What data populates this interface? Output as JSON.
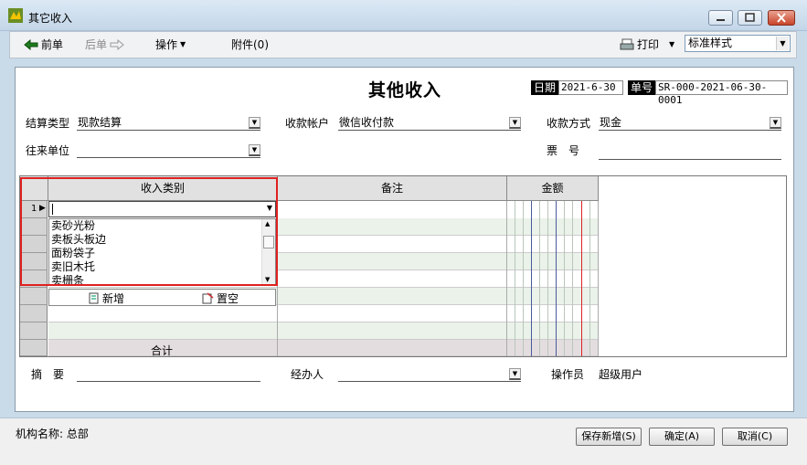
{
  "window": {
    "title": "其它收入"
  },
  "toolbar": {
    "prev": "前单",
    "next": "后单",
    "operate": "操作",
    "attach": "附件(0)",
    "print": "打印",
    "style": "标准样式"
  },
  "form": {
    "title": "其他收入",
    "date_label": "日期",
    "date_value": "2021-6-30",
    "no_label": "单号",
    "no_value": "SR-000-2021-06-30-0001",
    "settle_label": "结算类型",
    "settle_value": "现款结算",
    "account_label": "收款帐户",
    "account_value": "微信收付款",
    "method_label": "收款方式",
    "method_value": "现金",
    "partner_label": "往来单位",
    "partner_value": "",
    "ticket_label": "票　号",
    "ticket_value": "",
    "memo_label": "摘　要",
    "memo_value": "",
    "handler_label": "经办人",
    "handler_value": "",
    "operator_label": "操作员",
    "operator_value": "超级用户"
  },
  "grid": {
    "headers": {
      "category": "收入类别",
      "note": "备注",
      "amount": "金额"
    },
    "row1_num": "1",
    "options": [
      "卖砂光粉",
      "卖板头板边",
      "面粉袋子",
      "卖旧木托",
      "卖栅条"
    ],
    "add_label": "新增",
    "clear_label": "置空",
    "total_label": "合计"
  },
  "status": {
    "org": "机构名称: 总部",
    "save_new": "保存新增(S)",
    "ok": "确定(A)",
    "cancel": "取消(C)"
  }
}
